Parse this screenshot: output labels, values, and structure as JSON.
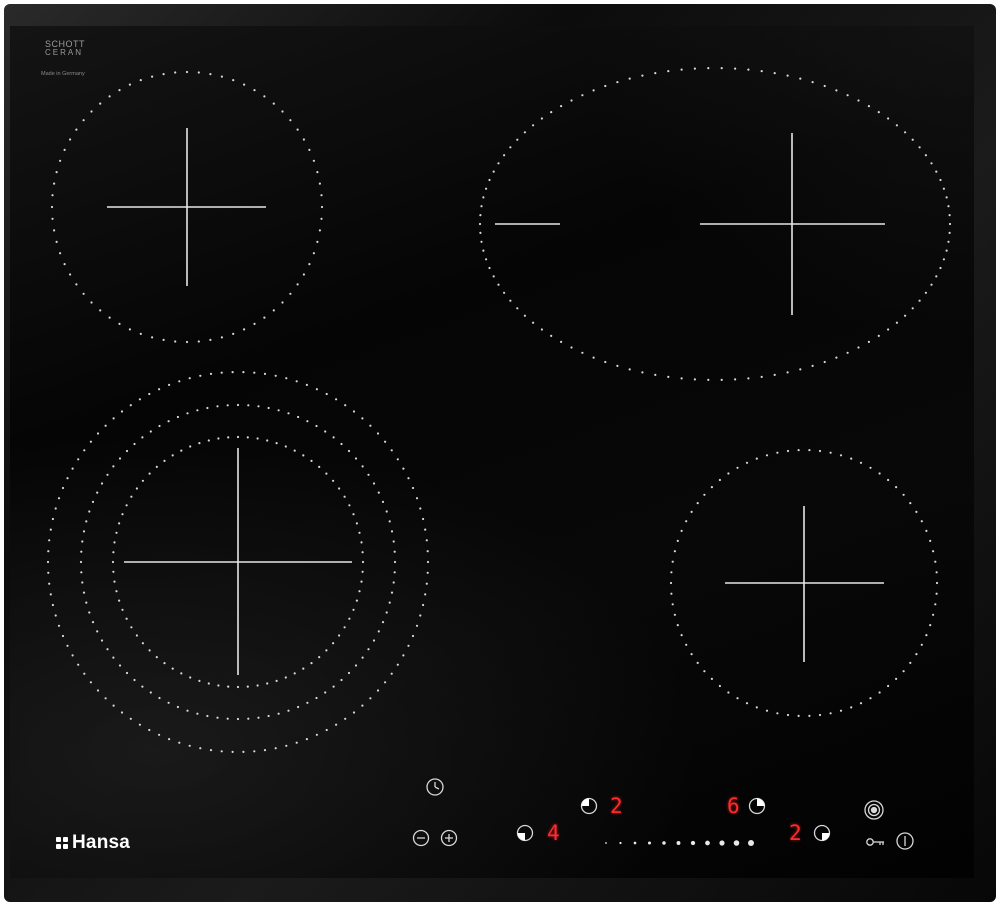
{
  "brand": {
    "schott": "SCHOTT",
    "ceran": "CERAN",
    "made_in": "Made in Germany",
    "logo": "Hansa"
  },
  "zone_displays": {
    "rear_left": "2",
    "rear_right": "6",
    "front_left": "4",
    "front_right": "2"
  },
  "icons": {
    "timer": "clock-icon",
    "minus": "minus-icon",
    "plus": "plus-icon",
    "zone_rear_left": "zone-selector-icon",
    "zone_rear_right": "zone-selector-icon",
    "zone_front_left": "zone-selector-icon",
    "zone_front_right": "zone-selector-icon",
    "dual_circuit": "dual-circuit-icon",
    "lock": "key-lock-icon",
    "power": "power-icon"
  },
  "slider": {
    "segments": 11,
    "level": 1.0
  },
  "colors": {
    "glass": "#050505",
    "markings": "#e8e8e8",
    "display_red": "#ff2b2b"
  }
}
